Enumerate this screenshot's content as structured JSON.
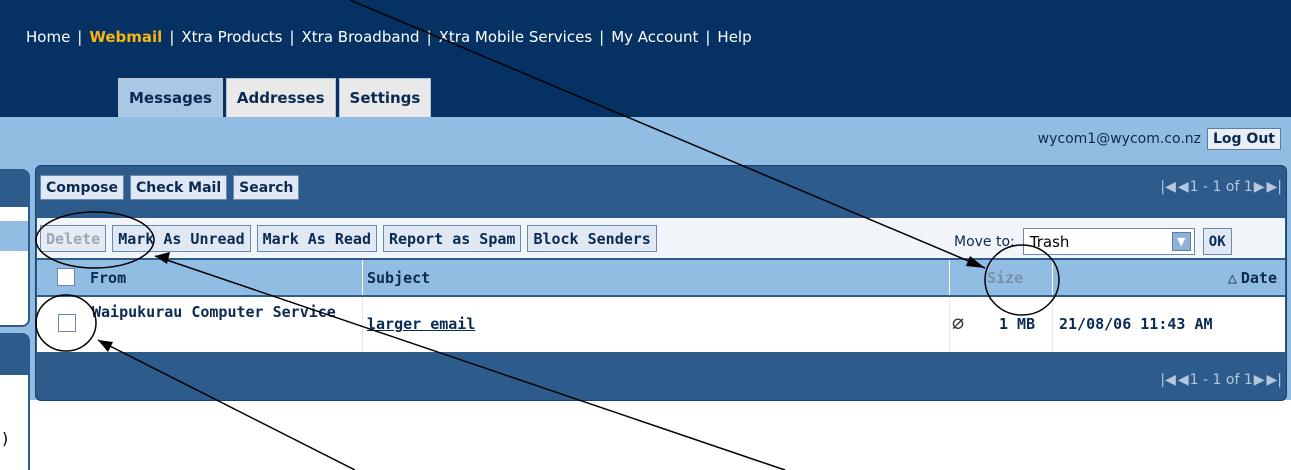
{
  "top_nav": {
    "items": [
      {
        "label": "Home",
        "active": false
      },
      {
        "label": "Webmail",
        "active": true
      },
      {
        "label": "Xtra Products",
        "active": false
      },
      {
        "label": "Xtra Broadband",
        "active": false
      },
      {
        "label": "Xtra Mobile Services",
        "active": false
      },
      {
        "label": "My Account",
        "active": false
      },
      {
        "label": "Help",
        "active": false
      }
    ],
    "separator": "|"
  },
  "tabs": [
    {
      "label": "Messages",
      "active": true
    },
    {
      "label": "Addresses",
      "active": false
    },
    {
      "label": "Settings",
      "active": false
    }
  ],
  "user": {
    "email": "wycom1@wycom.co.nz",
    "logout_label": "Log Out"
  },
  "toolbar": {
    "compose": "Compose",
    "check_mail": "Check Mail",
    "search": "Search"
  },
  "pager": {
    "first_icon": "first-page-icon",
    "prev_icon": "prev-page-icon",
    "text": "1 - 1 of 1",
    "next_icon": "next-page-icon",
    "last_icon": "last-page-icon"
  },
  "actions": {
    "delete": "Delete",
    "mark_unread": "Mark As Unread",
    "mark_read": "Mark As Read",
    "report_spam": "Report as Spam",
    "block_senders": "Block Senders",
    "move_to_label": "Move to:",
    "move_to_value": "Trash",
    "ok": "OK"
  },
  "table": {
    "columns": {
      "from": "From",
      "subject": "Subject",
      "size": "Size",
      "date": "Date"
    },
    "sort_icon": "sort-ascending-icon",
    "rows": [
      {
        "from": "Waipukurau Computer Service",
        "subject": "larger email",
        "attachment_icon": "paperclip-icon",
        "size": "1 MB",
        "date": "21/08/06 11:43 AM"
      }
    ]
  },
  "colors": {
    "navy": "#053263",
    "light_blue": "#92bde3",
    "panel_blue": "#2d5b8c",
    "active_nav": "#f5b614"
  }
}
